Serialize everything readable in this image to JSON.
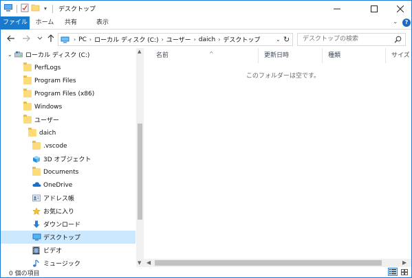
{
  "window": {
    "title": "デスクトップ",
    "qat_icons": [
      "computer-icon",
      "properties-check-icon",
      "new-folder-icon"
    ]
  },
  "ribbon": {
    "tabs": [
      "ファイル",
      "ホーム",
      "共有",
      "表示"
    ]
  },
  "address": {
    "segments": [
      "PC",
      "ローカル ディスク (C:)",
      "ユーザー",
      "daich",
      "デスクトップ"
    ]
  },
  "search": {
    "placeholder": "デスクトップの検索"
  },
  "tree": {
    "items": [
      {
        "label": "ローカル ディスク (C:)",
        "icon": "drive-icon"
      },
      {
        "label": "PerfLogs",
        "icon": "folder-icon"
      },
      {
        "label": "Program Files",
        "icon": "folder-icon"
      },
      {
        "label": "Program Files (x86)",
        "icon": "folder-icon"
      },
      {
        "label": "Windows",
        "icon": "folder-icon"
      },
      {
        "label": "ユーザー",
        "icon": "folder-icon"
      },
      {
        "label": "daich",
        "icon": "folder-icon"
      },
      {
        "label": ".vscode",
        "icon": "folder-icon"
      },
      {
        "label": "3D オブジェクト",
        "icon": "3d-objects-icon"
      },
      {
        "label": "Documents",
        "icon": "documents-icon"
      },
      {
        "label": "OneDrive",
        "icon": "onedrive-icon"
      },
      {
        "label": "アドレス帳",
        "icon": "contacts-icon"
      },
      {
        "label": "お気に入り",
        "icon": "favorites-icon"
      },
      {
        "label": "ダウンロード",
        "icon": "downloads-icon"
      },
      {
        "label": "デスクトップ",
        "icon": "desktop-icon",
        "selected": true
      },
      {
        "label": "ビデオ",
        "icon": "videos-icon"
      },
      {
        "label": "ミュージック",
        "icon": "music-icon"
      }
    ]
  },
  "columns": {
    "name": "名前",
    "modified": "更新日時",
    "type": "種類",
    "size": "サイズ"
  },
  "content": {
    "empty_message": "このフォルダーは空です。"
  },
  "status": {
    "item_count": "0 個の項目"
  },
  "colors": {
    "accent": "#1979ca",
    "selection": "#cce8ff",
    "folder": "#fcdb7a"
  }
}
